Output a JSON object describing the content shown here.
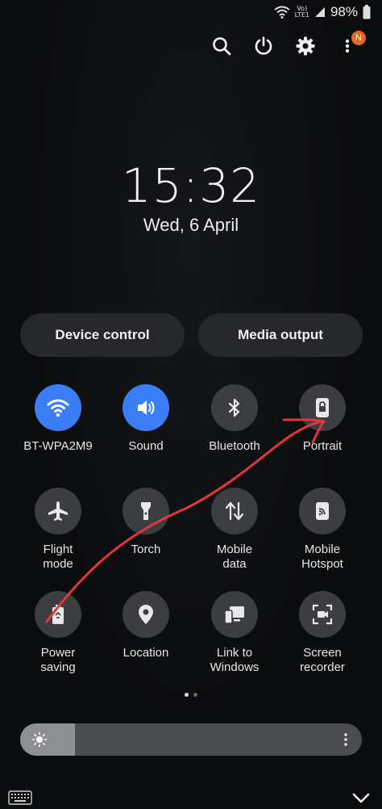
{
  "status_bar": {
    "lte_label_top": "Vo)",
    "lte_label_bottom": "LTE1",
    "battery": "98%",
    "icons": [
      "wifi-icon",
      "signal-icon",
      "battery-icon"
    ]
  },
  "top_actions": {
    "icons": [
      "search-icon",
      "power-icon",
      "settings-icon",
      "more-options-icon"
    ],
    "notification_badge": "N"
  },
  "clock": {
    "time": "15:32",
    "date": "Wed, 6 April"
  },
  "pills": {
    "device_control": "Device control",
    "media_output": "Media output"
  },
  "tiles": [
    {
      "label": "BT-WPA2M9",
      "icon": "wifi-icon",
      "active": true
    },
    {
      "label": "Sound",
      "icon": "speaker-icon",
      "active": true
    },
    {
      "label": "Bluetooth",
      "icon": "bluetooth-icon",
      "active": false
    },
    {
      "label": "Portrait",
      "icon": "rotation-lock-icon",
      "active": false
    },
    {
      "label": "Flight\nmode",
      "icon": "airplane-icon",
      "active": false
    },
    {
      "label": "Torch",
      "icon": "flashlight-icon",
      "active": false
    },
    {
      "label": "Mobile\ndata",
      "icon": "data-arrows-icon",
      "active": false
    },
    {
      "label": "Mobile\nHotspot",
      "icon": "hotspot-icon",
      "active": false
    },
    {
      "label": "Power\nsaving",
      "icon": "battery-saver-icon",
      "active": false
    },
    {
      "label": "Location",
      "icon": "location-pin-icon",
      "active": false
    },
    {
      "label": "Link to\nWindows",
      "icon": "link-windows-icon",
      "active": false
    },
    {
      "label": "Screen\nrecorder",
      "icon": "screen-recorder-icon",
      "active": false
    }
  ],
  "pagination": {
    "current_page": 1,
    "total_pages": 2
  },
  "brightness": {
    "level": 0.16
  },
  "colors": {
    "accent": "#3a7df5",
    "tile_inactive": "#3b3d41",
    "badge": "#e8651f",
    "annotation": "#e0383a"
  }
}
